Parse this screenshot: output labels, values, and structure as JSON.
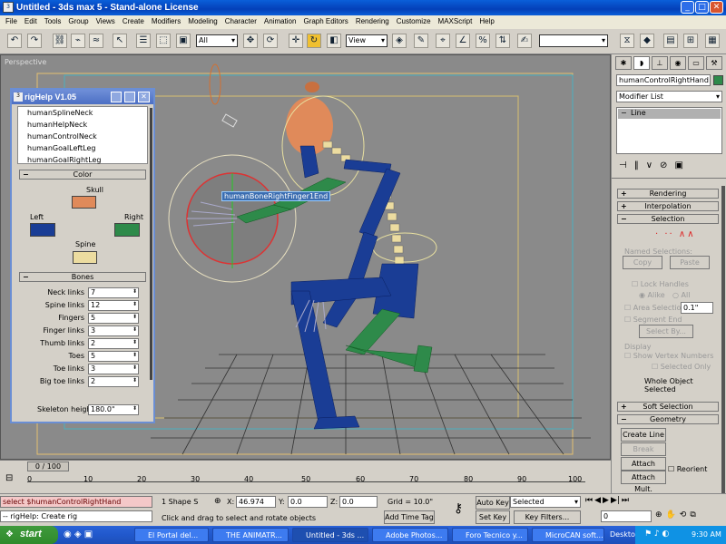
{
  "window": {
    "title": "Untitled - 3ds max 5 - Stand-alone License",
    "min": "_",
    "max": "□",
    "close": "✕"
  },
  "menu": [
    "File",
    "Edit",
    "Tools",
    "Group",
    "Views",
    "Create",
    "Modifiers",
    "Modeling",
    "Character",
    "Animation",
    "Graph Editors",
    "Rendering",
    "Customize",
    "MAXScript",
    "Help"
  ],
  "toolbar": {
    "selection_filter": "All",
    "ref_coord": "View"
  },
  "viewport": {
    "label": "Perspective",
    "tooltip": "humanBoneRightFinger1End"
  },
  "righelp": {
    "title": "rigHelp V1.05",
    "list": [
      "humanSplineNeck",
      "humanHelpNeck",
      "humanControlNeck",
      "humanGoalLeftLeg",
      "humanGoalRightLeg"
    ],
    "color_section": "Color",
    "skull": "Skull",
    "left": "Left",
    "right": "Right",
    "spine": "Spine",
    "colors": {
      "skull": "#e08a5a",
      "left": "#1a3d95",
      "right": "#2e8a4a",
      "spine": "#ecdca0"
    },
    "bones_section": "Bones",
    "params": [
      {
        "label": "Neck links",
        "value": "7"
      },
      {
        "label": "Spine links",
        "value": "12"
      },
      {
        "label": "Fingers",
        "value": "5"
      },
      {
        "label": "Finger links",
        "value": "3"
      },
      {
        "label": "Thumb links",
        "value": "2"
      },
      {
        "label": "Toes",
        "value": "5"
      },
      {
        "label": "Toe links",
        "value": "3"
      },
      {
        "label": "Big toe links",
        "value": "2"
      }
    ],
    "skeleton_height_label": "Skeleton height",
    "skeleton_height": "180.0\""
  },
  "cmd": {
    "object_name": "humanControlRightHand",
    "modifier_list": "Modifier List",
    "stack_item": "Line",
    "rendering": "Rendering",
    "interpolation": "Interpolation",
    "selection": "Selection",
    "named_selections": "Named Selections:",
    "copy": "Copy",
    "paste": "Paste",
    "lock_handles": "Lock Handles",
    "alike": "Alike",
    "all": "All",
    "area_selection": "Area Selection:",
    "area_value": "0.1\"",
    "segment_end": "Segment End",
    "select_by": "Select By...",
    "display": "Display",
    "show_vertex_numbers": "Show Vertex Numbers",
    "selected_only": "Selected Only",
    "whole_object": "Whole Object Selected",
    "soft_selection": "Soft Selection",
    "geometry": "Geometry",
    "create_line": "Create Line",
    "break": "Break",
    "attach": "Attach",
    "reorient": "Reorient",
    "attach_mult": "Attach Mult."
  },
  "timeline": {
    "frame": "0 / 100",
    "ticks": [
      "0",
      "10",
      "20",
      "30",
      "40",
      "50",
      "60",
      "70",
      "80",
      "90",
      "100"
    ]
  },
  "status": {
    "script_line1": "select $humanControlRightHand",
    "script_line2": "-- rigHelp: Create rig",
    "selected_count": "1 Shape S",
    "x_label": "X:",
    "x": "46.974",
    "y_label": "Y:",
    "y": "0.0",
    "z_label": "Z:",
    "z": "0.0",
    "grid": "Grid = 10.0\"",
    "prompt": "Click and drag to select and rotate objects",
    "add_time_tag": "Add Time Tag",
    "auto_key": "Auto Key",
    "auto_key_mode": "Selected",
    "set_key": "Set Key",
    "key_filters": "Key Filters...",
    "current_frame": "0"
  },
  "taskbar": {
    "start": "start",
    "tasks": [
      "El Portal del...",
      "THE ANIMATR...",
      "Untitled - 3ds ...",
      "Adobe Photos...",
      "Foro Tecnico y...",
      "MicroCAN soft..."
    ],
    "desktop": "Desktop",
    "clock": "9:30 AM"
  }
}
